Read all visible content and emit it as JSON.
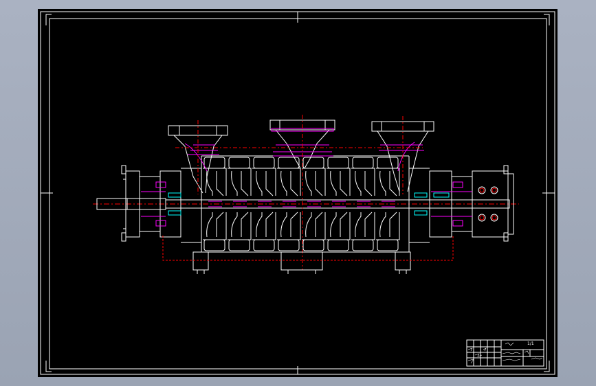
{
  "colors": {
    "background": "#a9b1c0",
    "sheet": "#000000",
    "line": "#ffffff",
    "magenta": "#ff00ff",
    "red": "#ff0000",
    "cyan": "#00ffff",
    "gray": "#808080"
  },
  "title_block": {
    "drawing_no": "1/1"
  }
}
